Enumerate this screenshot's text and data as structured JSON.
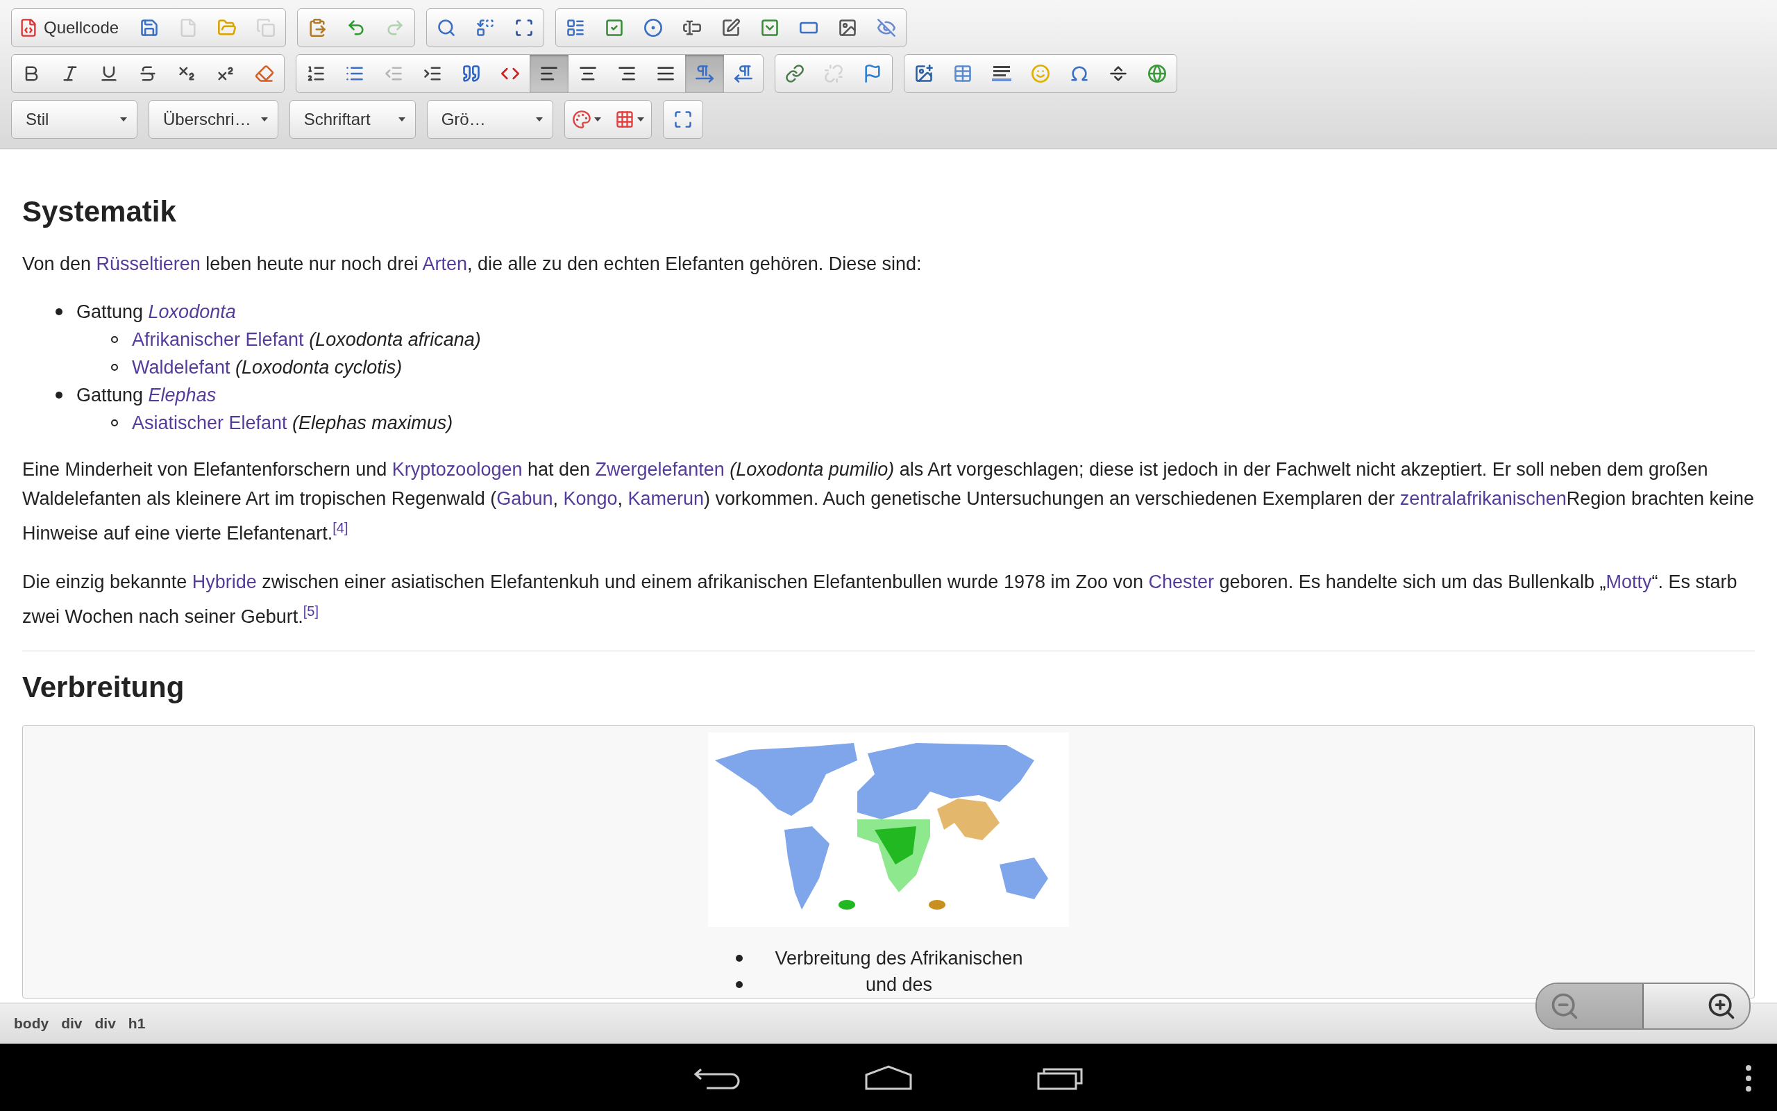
{
  "toolbar": {
    "rows": [
      {
        "groups": [
          {
            "buttons": [
              {
                "kind": "text",
                "label": "Quellcode",
                "selected": false,
                "disabled": false
              },
              {
                "kind": "icon",
                "selected": false,
                "disabled": false
              },
              {
                "kind": "icon",
                "selected": false,
                "disabled": true
              },
              {
                "kind": "icon",
                "selected": false,
                "disabled": false
              },
              {
                "kind": "icon",
                "selected": false,
                "disabled": true
              }
            ]
          },
          {
            "buttons": [
              {
                "kind": "icon",
                "selected": false,
                "disabled": false
              },
              {
                "kind": "icon",
                "selected": false,
                "disabled": false
              },
              {
                "kind": "icon",
                "selected": false,
                "disabled": true
              }
            ]
          },
          {
            "buttons": [
              {
                "kind": "icon",
                "selected": false,
                "disabled": false
              },
              {
                "kind": "icon",
                "selected": false,
                "disabled": false
              },
              {
                "kind": "icon",
                "selected": false,
                "disabled": false
              }
            ]
          },
          {
            "buttons": [
              {
                "kind": "icon",
                "selected": false,
                "disabled": false
              },
              {
                "kind": "icon",
                "selected": false,
                "disabled": false
              },
              {
                "kind": "icon",
                "selected": false,
                "disabled": false
              },
              {
                "kind": "icon",
                "selected": false,
                "disabled": false
              },
              {
                "kind": "icon",
                "selected": false,
                "disabled": false
              },
              {
                "kind": "icon",
                "selected": false,
                "disabled": false
              },
              {
                "kind": "icon",
                "selected": false,
                "disabled": false
              },
              {
                "kind": "icon",
                "selected": false,
                "disabled": false
              },
              {
                "kind": "icon",
                "selected": false,
                "disabled": false
              }
            ]
          }
        ]
      },
      {
        "groups": [
          {
            "buttons": [
              {
                "kind": "icon",
                "selected": false,
                "disabled": false
              },
              {
                "kind": "icon",
                "selected": false,
                "disabled": false
              },
              {
                "kind": "icon",
                "selected": false,
                "disabled": false
              },
              {
                "kind": "icon",
                "selected": false,
                "disabled": false
              },
              {
                "kind": "icon",
                "selected": false,
                "disabled": false
              },
              {
                "kind": "icon",
                "selected": false,
                "disabled": false
              },
              {
                "kind": "icon",
                "selected": false,
                "disabled": false
              }
            ]
          },
          {
            "buttons": [
              {
                "kind": "icon",
                "selected": false,
                "disabled": false
              },
              {
                "kind": "icon",
                "selected": false,
                "disabled": false
              },
              {
                "kind": "icon",
                "selected": false,
                "disabled": true
              },
              {
                "kind": "icon",
                "selected": false,
                "disabled": false
              },
              {
                "kind": "icon",
                "selected": false,
                "disabled": false
              },
              {
                "kind": "icon",
                "selected": false,
                "disabled": false
              },
              {
                "kind": "icon",
                "selected": true,
                "disabled": false
              },
              {
                "kind": "icon",
                "selected": false,
                "disabled": false
              },
              {
                "kind": "icon",
                "selected": false,
                "disabled": false
              },
              {
                "kind": "icon",
                "selected": false,
                "disabled": false
              },
              {
                "kind": "icon",
                "selected": true,
                "disabled": false
              },
              {
                "kind": "icon",
                "selected": false,
                "disabled": false
              }
            ]
          },
          {
            "buttons": [
              {
                "kind": "icon",
                "selected": false,
                "disabled": false
              },
              {
                "kind": "icon",
                "selected": false,
                "disabled": true
              },
              {
                "kind": "icon",
                "selected": false,
                "disabled": false
              }
            ]
          },
          {
            "buttons": [
              {
                "kind": "icon",
                "selected": false,
                "disabled": false
              },
              {
                "kind": "icon",
                "selected": false,
                "disabled": false
              },
              {
                "kind": "icon",
                "selected": false,
                "disabled": false
              },
              {
                "kind": "icon",
                "selected": false,
                "disabled": false
              },
              {
                "kind": "icon",
                "selected": false,
                "disabled": false
              },
              {
                "kind": "icon",
                "selected": false,
                "disabled": false
              },
              {
                "kind": "icon",
                "selected": false,
                "disabled": false
              }
            ]
          }
        ]
      },
      {
        "groups": [
          {
            "buttons": [
              {
                "kind": "select",
                "label": "Stil"
              }
            ]
          },
          {
            "buttons": [
              {
                "kind": "select",
                "label": "Überschri…"
              }
            ]
          },
          {
            "buttons": [
              {
                "kind": "select",
                "label": "Schriftart"
              }
            ]
          },
          {
            "buttons": [
              {
                "kind": "select",
                "label": "Grö…"
              }
            ]
          },
          {
            "buttons": [
              {
                "kind": "menu"
              },
              {
                "kind": "menu"
              }
            ]
          },
          {
            "buttons": [
              {
                "kind": "icon",
                "selected": false,
                "disabled": false
              }
            ]
          }
        ]
      }
    ]
  },
  "content": [
    {
      "kind": "heading",
      "text": "Systematik"
    },
    {
      "kind": "paragraph",
      "parts": [
        {
          "kind": "plain",
          "text": "Von den "
        },
        {
          "kind": "link",
          "text": "Rüsseltieren"
        },
        {
          "kind": "plain",
          "text": " leben heute nur noch drei "
        },
        {
          "kind": "link",
          "text": "Arten"
        },
        {
          "kind": "plain",
          "text": ", die alle zu den echten Elefanten gehören. Diese sind:"
        }
      ]
    },
    {
      "kind": "list",
      "items": [
        {
          "parts": [
            {
              "kind": "plain",
              "text": "Gattung "
            },
            {
              "kind": "italic-link",
              "text": "Loxodonta"
            }
          ],
          "children": [
            {
              "parts": [
                {
                  "kind": "link",
                  "text": "Afrikanischer Elefant"
                },
                {
                  "kind": "italic",
                  "text": " (Loxodonta africana)"
                }
              ]
            },
            {
              "parts": [
                {
                  "kind": "link",
                  "text": "Waldelefant"
                },
                {
                  "kind": "italic",
                  "text": " (Loxodonta cyclotis)"
                }
              ]
            }
          ]
        },
        {
          "parts": [
            {
              "kind": "plain",
              "text": "Gattung "
            },
            {
              "kind": "italic-link",
              "text": "Elephas"
            }
          ],
          "children": [
            {
              "parts": [
                {
                  "kind": "link",
                  "text": "Asiatischer Elefant"
                },
                {
                  "kind": "italic",
                  "text": " (Elephas maximus)"
                }
              ]
            }
          ]
        }
      ]
    },
    {
      "kind": "paragraph",
      "parts": [
        {
          "kind": "plain",
          "text": "Eine Minderheit von Elefantenforschern und "
        },
        {
          "kind": "link",
          "text": "Kryptozoologen"
        },
        {
          "kind": "plain",
          "text": " hat den "
        },
        {
          "kind": "link",
          "text": "Zwergelefanten"
        },
        {
          "kind": "italic",
          "text": " (Loxodonta pumilio)"
        },
        {
          "kind": "plain",
          "text": " als Art vorgeschlagen; diese ist jedoch in der Fachwelt nicht akzeptiert. Er soll neben dem großen Waldelefanten als kleinere Art im tropischen Regenwald ("
        },
        {
          "kind": "link",
          "text": "Gabun"
        },
        {
          "kind": "plain",
          "text": ", "
        },
        {
          "kind": "link",
          "text": "Kongo"
        },
        {
          "kind": "plain",
          "text": ", "
        },
        {
          "kind": "link",
          "text": "Kamerun"
        },
        {
          "kind": "plain",
          "text": ") vorkommen. Auch genetische Untersuchungen an verschiedenen Exemplaren der "
        },
        {
          "kind": "link",
          "text": "zentralafrikanischen"
        },
        {
          "kind": "plain",
          "text": "Region brachten keine Hinweise auf eine vierte Elefantenart."
        },
        {
          "kind": "ref",
          "text": "[4]"
        }
      ]
    },
    {
      "kind": "paragraph",
      "parts": [
        {
          "kind": "plain",
          "text": "Die einzig bekannte "
        },
        {
          "kind": "link",
          "text": "Hybride"
        },
        {
          "kind": "plain",
          "text": " zwischen einer asiatischen Elefantenkuh und einem afrikanischen Elefantenbullen wurde 1978 im Zoo von "
        },
        {
          "kind": "link",
          "text": "Chester"
        },
        {
          "kind": "plain",
          "text": " geboren. Es handelte sich um das Bullenkalb „"
        },
        {
          "kind": "link",
          "text": "Motty"
        },
        {
          "kind": "plain",
          "text": "“. Es starb zwei Wochen nach seiner Geburt."
        },
        {
          "kind": "ref",
          "text": "[5]"
        }
      ]
    },
    {
      "kind": "rule"
    },
    {
      "kind": "heading",
      "text": "Verbreitung"
    },
    {
      "kind": "figure",
      "caption_items": [
        "Verbreitung des Afrikanischen",
        "und des"
      ]
    }
  ],
  "status_bar": {
    "path": [
      "body",
      "div",
      "div",
      "h1"
    ]
  }
}
